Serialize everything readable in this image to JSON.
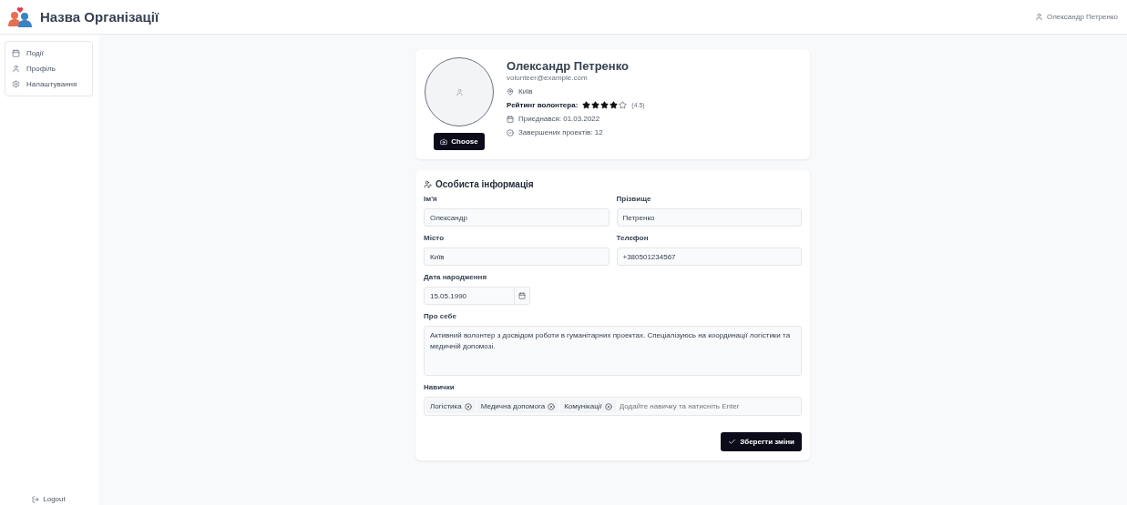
{
  "header": {
    "org_name": "Назва Організації",
    "user_name": "Олександр Петренко"
  },
  "sidebar": {
    "items": [
      {
        "label": "Події",
        "kind": "calendar"
      },
      {
        "label": "Профіль",
        "kind": "user"
      },
      {
        "label": "Налаштування",
        "kind": "gear"
      }
    ],
    "logout": "Logout"
  },
  "profile": {
    "name": "Олександр Петренко",
    "email": "volunteer@example.com",
    "city": "Київ",
    "rating_label": "Рейтинг волонтера:",
    "stars": 4,
    "rating_value": "(4.5)",
    "joined": "Приєднався: 01.03.2022",
    "projects": "Завершених проектів: 12",
    "choose_button": "Choose"
  },
  "form": {
    "title": "Особиста інформація",
    "fields": [
      {
        "label": "Ім'я",
        "value": "Олександр"
      },
      {
        "label": "Прізвище",
        "value": "Петренко"
      },
      {
        "label": "Місто",
        "value": "Київ"
      },
      {
        "label": "Телефон",
        "value": "+380501234567"
      }
    ],
    "birth_date": {
      "label": "Дата народження",
      "value": "15.05.1990"
    },
    "about": {
      "label": "Про себе",
      "value": "Активний волонтер з досвідом роботи в гуманітарних проектах. Спеціалізуюсь на координації логістики та медичній допомозі."
    },
    "skills": {
      "label": "Навички",
      "tags": [
        "Логістика",
        "Медична допомога",
        "Комунікації"
      ],
      "placeholder": "Додайте навичку та натисніть Enter"
    },
    "save_button": "Зберегти зміни"
  }
}
